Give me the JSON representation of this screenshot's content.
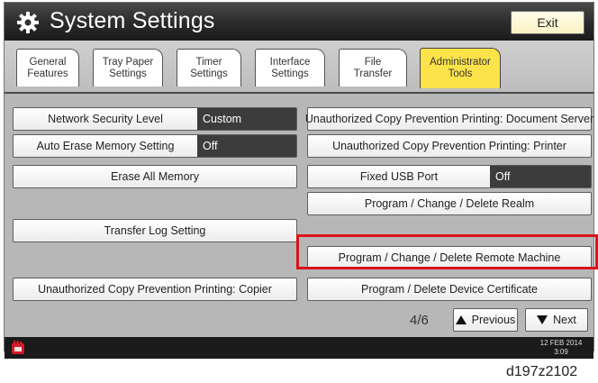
{
  "header": {
    "title": "System Settings",
    "exit_label": "Exit"
  },
  "tabs": [
    {
      "label": "General\nFeatures",
      "active": false
    },
    {
      "label": "Tray Paper\nSettings",
      "active": false
    },
    {
      "label": "Timer\nSettings",
      "active": false
    },
    {
      "label": "Interface\nSettings",
      "active": false
    },
    {
      "label": "File\nTransfer",
      "active": false
    },
    {
      "label": "Administrator\nTools",
      "active": true
    }
  ],
  "left_column": {
    "network_security_level": {
      "label": "Network Security Level",
      "value": "Custom"
    },
    "auto_erase_memory": {
      "label": "Auto Erase Memory Setting",
      "value": "Off"
    },
    "erase_all_memory": "Erase All Memory",
    "transfer_log_setting": "Transfer Log Setting",
    "copy_prevention_copier": "Unauthorized Copy Prevention Printing: Copier"
  },
  "right_column": {
    "copy_prevention_document_server": "Unauthorized Copy Prevention Printing: Document Server",
    "copy_prevention_printer": "Unauthorized Copy Prevention Printing: Printer",
    "fixed_usb_port": {
      "label": "Fixed USB Port",
      "value": "Off"
    },
    "delete_realm": "Program / Change / Delete Realm",
    "delete_remote_machine": "Program / Change / Delete Remote Machine",
    "delete_device_certificate": "Program / Delete Device Certificate"
  },
  "pager": {
    "page": "4/6",
    "previous_label": "Previous",
    "next_label": "Next"
  },
  "status_bar": {
    "date": "12 FEB 2014",
    "time": "3:09"
  },
  "figure_code": "d197z2102",
  "colors": {
    "active_tab": "#fde34a",
    "header": "#2a2a2a",
    "highlight": "#d9121b",
    "value_field": "#3c3c3c"
  }
}
